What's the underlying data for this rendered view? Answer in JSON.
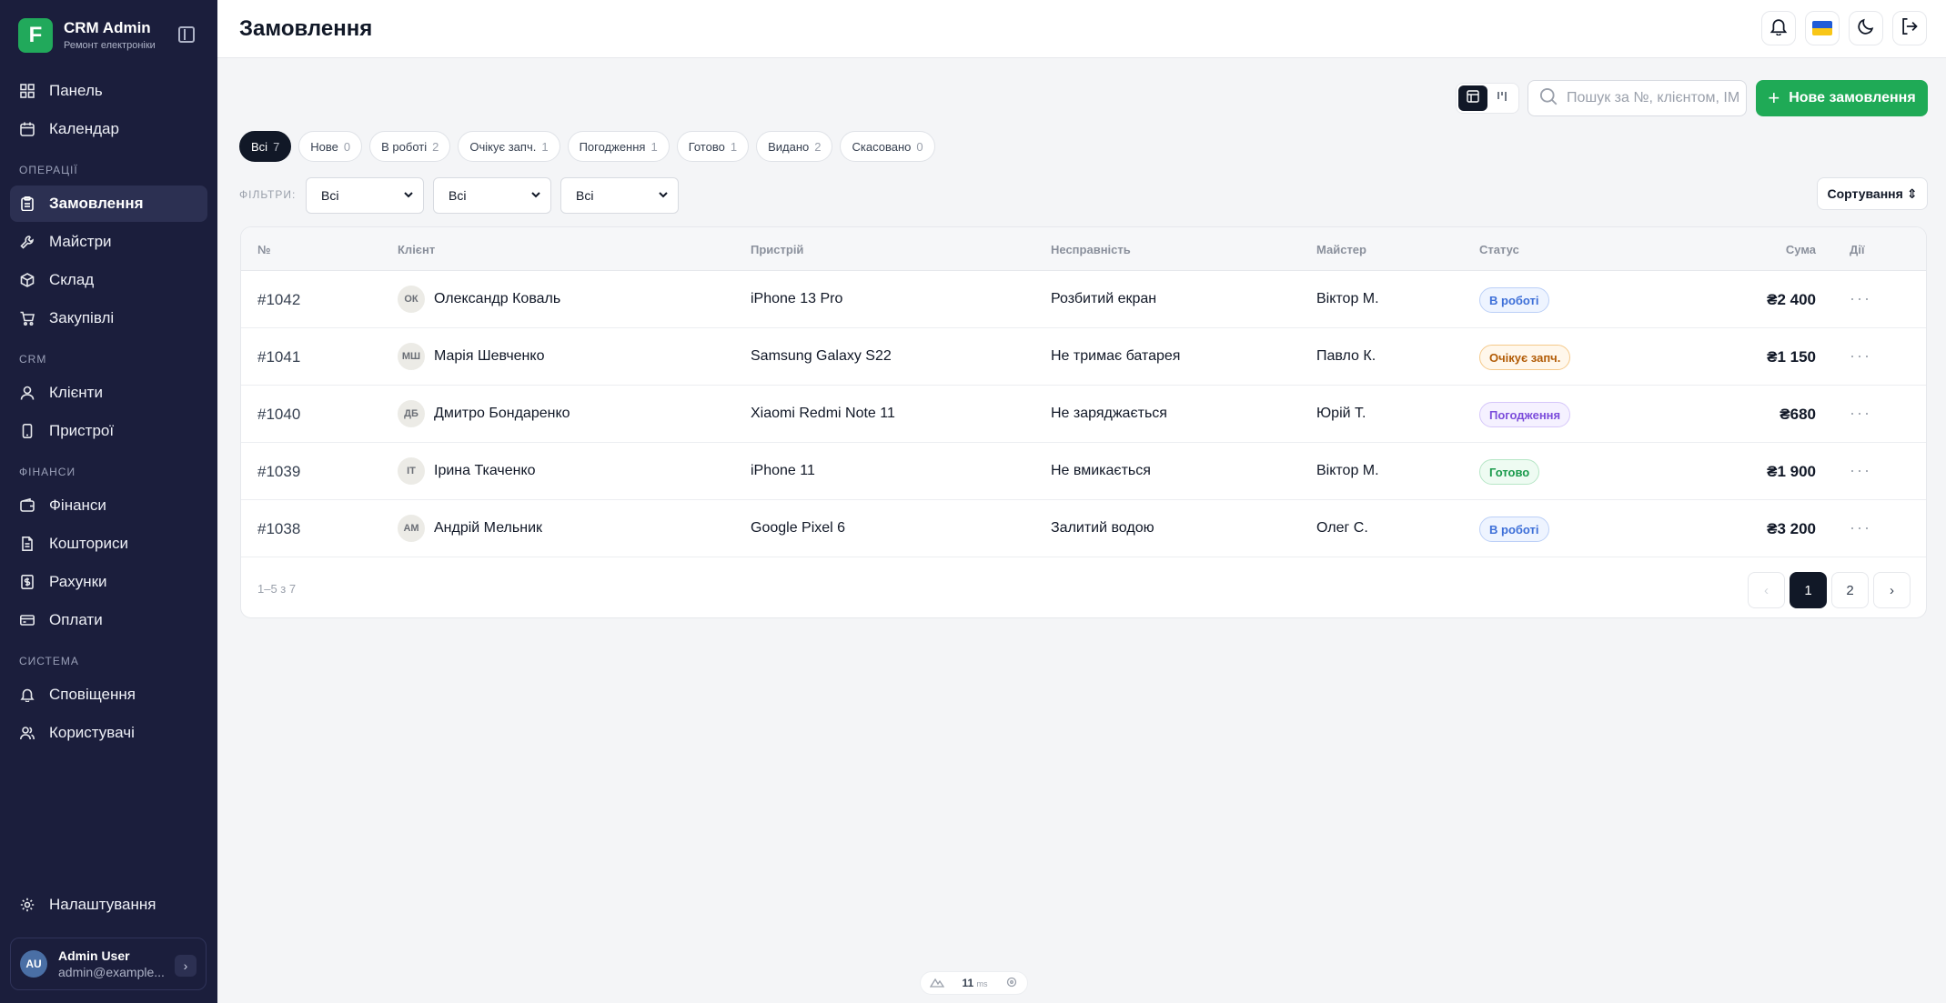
{
  "brand": {
    "logo_letter": "F",
    "title": "CRM Admin",
    "subtitle": "Ремонт електроніки",
    "accent": "#21a95b"
  },
  "sidebar": {
    "top_items": [
      {
        "label": "Панель",
        "icon": "dashboard-icon"
      },
      {
        "label": "Календар",
        "icon": "calendar-icon"
      }
    ],
    "sections": [
      {
        "title": "Операції",
        "items": [
          {
            "label": "Замовлення",
            "icon": "clipboard-icon",
            "active": true
          },
          {
            "label": "Майстри",
            "icon": "wrench-icon"
          },
          {
            "label": "Склад",
            "icon": "box-icon"
          },
          {
            "label": "Закупівлі",
            "icon": "cart-icon"
          }
        ]
      },
      {
        "title": "CRM",
        "items": [
          {
            "label": "Клієнти",
            "icon": "user-icon"
          },
          {
            "label": "Пристрої",
            "icon": "phone-icon"
          }
        ]
      },
      {
        "title": "Фінанси",
        "items": [
          {
            "label": "Фінанси",
            "icon": "wallet-icon"
          },
          {
            "label": "Кошториси",
            "icon": "document-icon"
          },
          {
            "label": "Рахунки",
            "icon": "invoice-icon"
          },
          {
            "label": "Оплати",
            "icon": "card-icon"
          }
        ]
      },
      {
        "title": "Система",
        "items": [
          {
            "label": "Сповіщення",
            "icon": "bell-icon"
          },
          {
            "label": "Користувачі",
            "icon": "users-icon"
          }
        ]
      }
    ],
    "settings_label": "Налаштування",
    "user": {
      "initials": "AU",
      "name": "Admin User",
      "email": "admin@example..."
    }
  },
  "header": {
    "title": "Замовлення"
  },
  "toolbar": {
    "search_placeholder": "Пошук за №, клієнтом, IMEI",
    "new_order_label": "Нове замовлення",
    "sort_label": "Сортування"
  },
  "status_chips": [
    {
      "label": "Всі",
      "count": "7",
      "active": true
    },
    {
      "label": "Нове",
      "count": "0"
    },
    {
      "label": "В роботі",
      "count": "2"
    },
    {
      "label": "Очікує запч.",
      "count": "1"
    },
    {
      "label": "Погодження",
      "count": "1"
    },
    {
      "label": "Готово",
      "count": "1"
    },
    {
      "label": "Видано",
      "count": "2"
    },
    {
      "label": "Скасовано",
      "count": "0"
    }
  ],
  "filters": {
    "label": "Фільтри:",
    "selects": [
      "Всі",
      "Всі",
      "Всі"
    ]
  },
  "table": {
    "columns": [
      "№",
      "Клієнт",
      "Пристрій",
      "Несправність",
      "Майстер",
      "Статус",
      "Сума",
      "Дії"
    ],
    "rows": [
      {
        "num": "#1042",
        "initials": "ОК",
        "client": "Олександр Коваль",
        "device": "iPhone 13 Pro",
        "issue": "Розбитий екран",
        "master": "Віктор М.",
        "status": "В роботі",
        "status_color": "blue",
        "sum": "₴2 400"
      },
      {
        "num": "#1041",
        "initials": "МШ",
        "client": "Марія Шевченко",
        "device": "Samsung Galaxy S22",
        "issue": "Не тримає батарея",
        "master": "Павло К.",
        "status": "Очікує запч.",
        "status_color": "orange",
        "sum": "₴1 150"
      },
      {
        "num": "#1040",
        "initials": "ДБ",
        "client": "Дмитро Бондаренко",
        "device": "Xiaomi Redmi Note 11",
        "issue": "Не заряджається",
        "master": "Юрій Т.",
        "status": "Погодження",
        "status_color": "purple",
        "sum": "₴680"
      },
      {
        "num": "#1039",
        "initials": "ІТ",
        "client": "Ірина Ткаченко",
        "device": "iPhone 11",
        "issue": "Не вмикається",
        "master": "Віктор М.",
        "status": "Готово",
        "status_color": "green",
        "sum": "₴1 900"
      },
      {
        "num": "#1038",
        "initials": "АМ",
        "client": "Андрій Мельник",
        "device": "Google Pixel 6",
        "issue": "Залитий водою",
        "master": "Олег С.",
        "status": "В роботі",
        "status_color": "blue",
        "sum": "₴3 200"
      }
    ],
    "range_text": "1–5 з 7",
    "pages": [
      "1",
      "2"
    ],
    "current_page": "1"
  },
  "dev_indicator": {
    "value": "11",
    "unit": "ms"
  }
}
